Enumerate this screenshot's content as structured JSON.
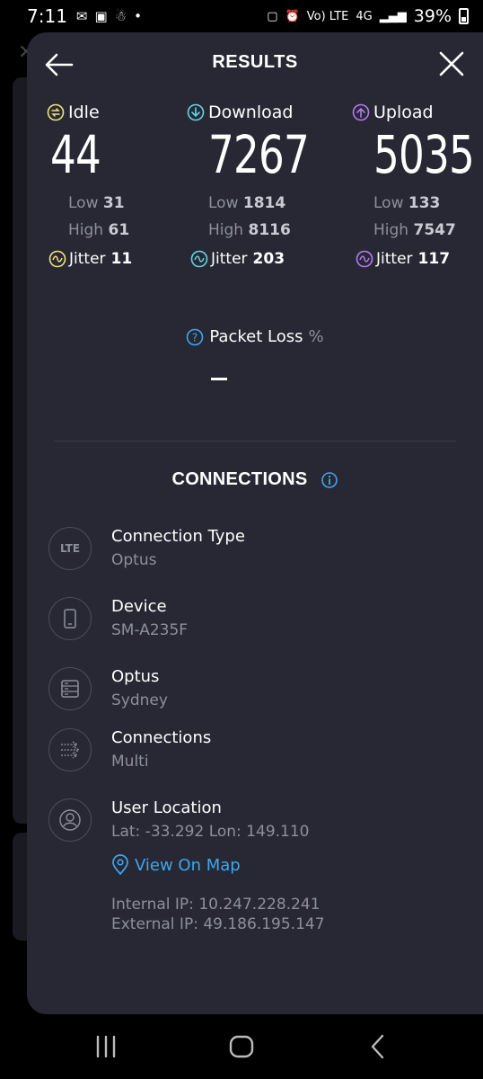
{
  "status_bar": {
    "time": "7:11",
    "network": "4G",
    "volte": "Vo) LTE",
    "battery": "39%"
  },
  "header": {
    "title": "RESULTS"
  },
  "metrics": {
    "idle": {
      "label": "Idle",
      "value": "44",
      "low_label": "Low",
      "low": "31",
      "high_label": "High",
      "high": "61",
      "jitter_label": "Jitter",
      "jitter": "11",
      "color": "#f4e27a"
    },
    "download": {
      "label": "Download",
      "value": "7267",
      "low_label": "Low",
      "low": "1814",
      "high_label": "High",
      "high": "8116",
      "jitter_label": "Jitter",
      "jitter": "203",
      "color": "#5fd8e4"
    },
    "upload": {
      "label": "Upload",
      "value": "5035",
      "low_label": "Low",
      "low": "133",
      "high_label": "High",
      "high": "7547",
      "jitter_label": "Jitter",
      "jitter": "117",
      "color": "#b37bf0"
    }
  },
  "packet_loss": {
    "label": "Packet Loss",
    "unit": "%"
  },
  "connections": {
    "title": "CONNECTIONS",
    "items": [
      {
        "label": "Connection Type",
        "value": "Optus",
        "icon": "lte-icon",
        "icon_text": "LTE"
      },
      {
        "label": "Device",
        "value": "SM-A235F",
        "icon": "phone-icon"
      },
      {
        "label": "Optus",
        "value": "Sydney",
        "icon": "server-icon"
      },
      {
        "label": "Connections",
        "value": "Multi",
        "icon": "multi-connection-icon"
      },
      {
        "label": "User Location",
        "value": "Lat: -33.292 Lon: 149.110",
        "icon": "user-icon"
      }
    ],
    "map_link": "View On Map",
    "internal_ip": "Internal IP: 10.247.228.241",
    "external_ip": "External IP: 49.186.195.147"
  },
  "colors": {
    "panel": "#272834",
    "accent_blue": "#3ea6f0",
    "muted_text": "#8e8f9c"
  }
}
